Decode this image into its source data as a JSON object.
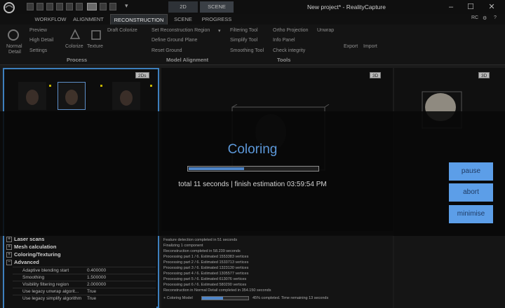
{
  "titlebar": {
    "title": "New project* - RealityCapture",
    "ctx_tab_2d": "2D",
    "ctx_tab_scene": "SCENE",
    "user": "RC"
  },
  "ribbon_tabs": [
    "WORKFLOW",
    "ALIGNMENT",
    "RECONSTRUCTION",
    "SCENE",
    "PROGRESS"
  ],
  "ribbon": {
    "normal_detail": "Normal",
    "normal_detail2": "Detail",
    "preview": "Preview",
    "high_detail": "High Detail",
    "settings": "Settings",
    "colorize": "Colorize",
    "texture": "Texture",
    "draft_colorize": "Draft Colorize",
    "set_region": "Set Reconstruction Region",
    "define_ground": "Define Ground Plane",
    "reset_ground": "Reset Ground",
    "filtering": "Filtering Tool",
    "simplify": "Simplify Tool",
    "smoothing": "Smoothing Tool",
    "ortho": "Ortho Projection",
    "unwrap": "Unwrap",
    "info_panel": "Info Panel",
    "check_integrity": "Check integrity",
    "export": "Export",
    "import": "Import",
    "group_process": "Process",
    "group_model": "Model Alignment",
    "group_tools": "Tools"
  },
  "panels": {
    "tag_2ds": "2Ds",
    "tag_3d": "3D",
    "tag_3d2": "3D"
  },
  "overlay": {
    "title": "Coloring",
    "status": "total 11 seconds | finish estimation 03:59:54 PM",
    "progress": 0.43,
    "pause": "pause",
    "abort": "abort",
    "minimise": "minimise"
  },
  "properties": {
    "sections": [
      "Laser scans",
      "Mesh calculation",
      "Coloring/Texturing",
      "Advanced"
    ],
    "rows": [
      {
        "key": "Adaptive blending start",
        "value": "0.400000"
      },
      {
        "key": "Smoothing",
        "value": "1.500000"
      },
      {
        "key": "Visibility filtering region",
        "value": "2.000000"
      },
      {
        "key": "Use legacy unwrap algorit...",
        "value": "True"
      },
      {
        "key": "Use legacy simplify algorithm",
        "value": "True"
      }
    ]
  },
  "log": [
    "Feature detection completed in 51 seconds",
    "Finalizing 1 component",
    "Reconstruction completed in 58.239 seconds",
    "Processing part 1 / 6. Estimated 1553383 vertices",
    "Processing part 2 / 6. Estimated 1533713 vertices",
    "Processing part 3 / 6. Estimated 1323130 vertices",
    "Processing part 4 / 6. Estimated 1305577 vertices",
    "Processing part 5 / 6. Estimated 613076 vertices",
    "Processing part 6 / 6. Estimated 580290 vertices",
    "Reconstruction in Normal Detail completed in 354.150 seconds"
  ],
  "log_progress": {
    "label": "+ Coloring Model",
    "text": "45% completed. Time remaining 13 seconds"
  }
}
